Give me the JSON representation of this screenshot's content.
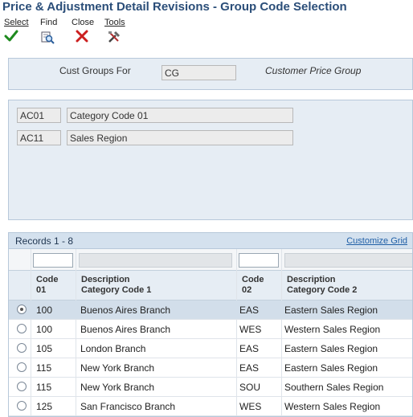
{
  "window": {
    "title": "Price & Adjustment Detail Revisions - Group Code Selection"
  },
  "toolbar": {
    "select_label": "Select",
    "find_label": "Find",
    "close_label": "Close",
    "tools_label": "Tools"
  },
  "header": {
    "cust_groups_label": "Cust Groups For",
    "cust_groups_value": "CG",
    "cust_groups_desc": "Customer Price Group"
  },
  "category_codes": [
    {
      "code": "AC01",
      "desc": "Category Code 01"
    },
    {
      "code": "AC11",
      "desc": "Sales Region"
    }
  ],
  "grid": {
    "records_label": "Records 1 - 8",
    "customize_label": "Customize Grid",
    "columns": {
      "code01_l1": "Code",
      "code01_l2": "01",
      "desc1_l1": "Description",
      "desc1_l2": "Category Code 1",
      "code02_l1": "Code",
      "code02_l2": "02",
      "desc2_l1": "Description",
      "desc2_l2": "Category Code 2"
    },
    "rows": [
      {
        "code01": "100",
        "desc1": "Buenos Aires Branch",
        "code02": "EAS",
        "desc2": "Eastern Sales Region"
      },
      {
        "code01": "100",
        "desc1": "Buenos Aires Branch",
        "code02": "WES",
        "desc2": "Western Sales Region"
      },
      {
        "code01": "105",
        "desc1": "London Branch",
        "code02": "EAS",
        "desc2": "Eastern Sales Region"
      },
      {
        "code01": "115",
        "desc1": "New York Branch",
        "code02": "EAS",
        "desc2": "Eastern Sales Region"
      },
      {
        "code01": "115",
        "desc1": "New York Branch",
        "code02": "SOU",
        "desc2": "Southern Sales Region"
      },
      {
        "code01": "125",
        "desc1": "San Francisco Branch",
        "code02": "WES",
        "desc2": "Western Sales Region"
      }
    ]
  },
  "colors": {
    "title": "#2b4e79",
    "panel": "#e6edf4",
    "selected_row": "#d2deea",
    "link": "#1f5fa6"
  },
  "icons": {
    "select": "check-icon",
    "find": "find-icon",
    "close": "close-x-icon",
    "tools": "tools-icon"
  }
}
